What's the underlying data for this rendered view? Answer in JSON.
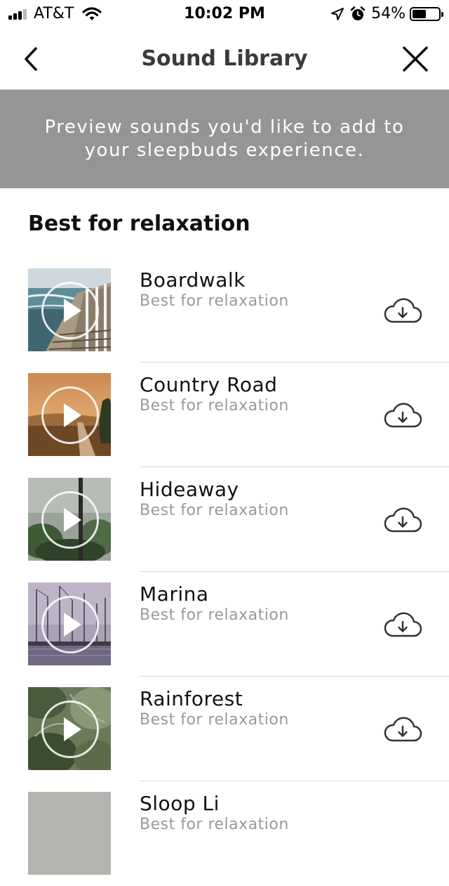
{
  "status_bar": {
    "carrier": "AT&T",
    "time": "10:02 PM",
    "battery_percent": "54%",
    "battery_level": 0.54,
    "signal_bars_filled": 3,
    "signal_bars_total": 4,
    "icons": [
      "wifi-icon",
      "location-arrow-icon",
      "alarm-clock-icon",
      "battery-icon"
    ]
  },
  "nav": {
    "title": "Sound Library",
    "back_icon": "chevron-left-icon",
    "close_icon": "close-icon"
  },
  "banner": {
    "text": "Preview sounds you'd like to add to your sleepbuds experience."
  },
  "section": {
    "title": "Best for relaxation"
  },
  "sounds": [
    {
      "title": "Boardwalk",
      "subtitle": "Best for relaxation"
    },
    {
      "title": "Country Road",
      "subtitle": "Best for relaxation"
    },
    {
      "title": "Hideaway",
      "subtitle": "Best for relaxation"
    },
    {
      "title": "Marina",
      "subtitle": "Best for relaxation"
    },
    {
      "title": "Rainforest",
      "subtitle": "Best for relaxation"
    },
    {
      "title": "Sloop Li",
      "subtitle": "Best for relaxation"
    }
  ],
  "colors": {
    "banner_bg": "#959595",
    "divider": "#d8d8d8",
    "subtitle": "#9a9a9a",
    "title": "#3a3a3a"
  }
}
